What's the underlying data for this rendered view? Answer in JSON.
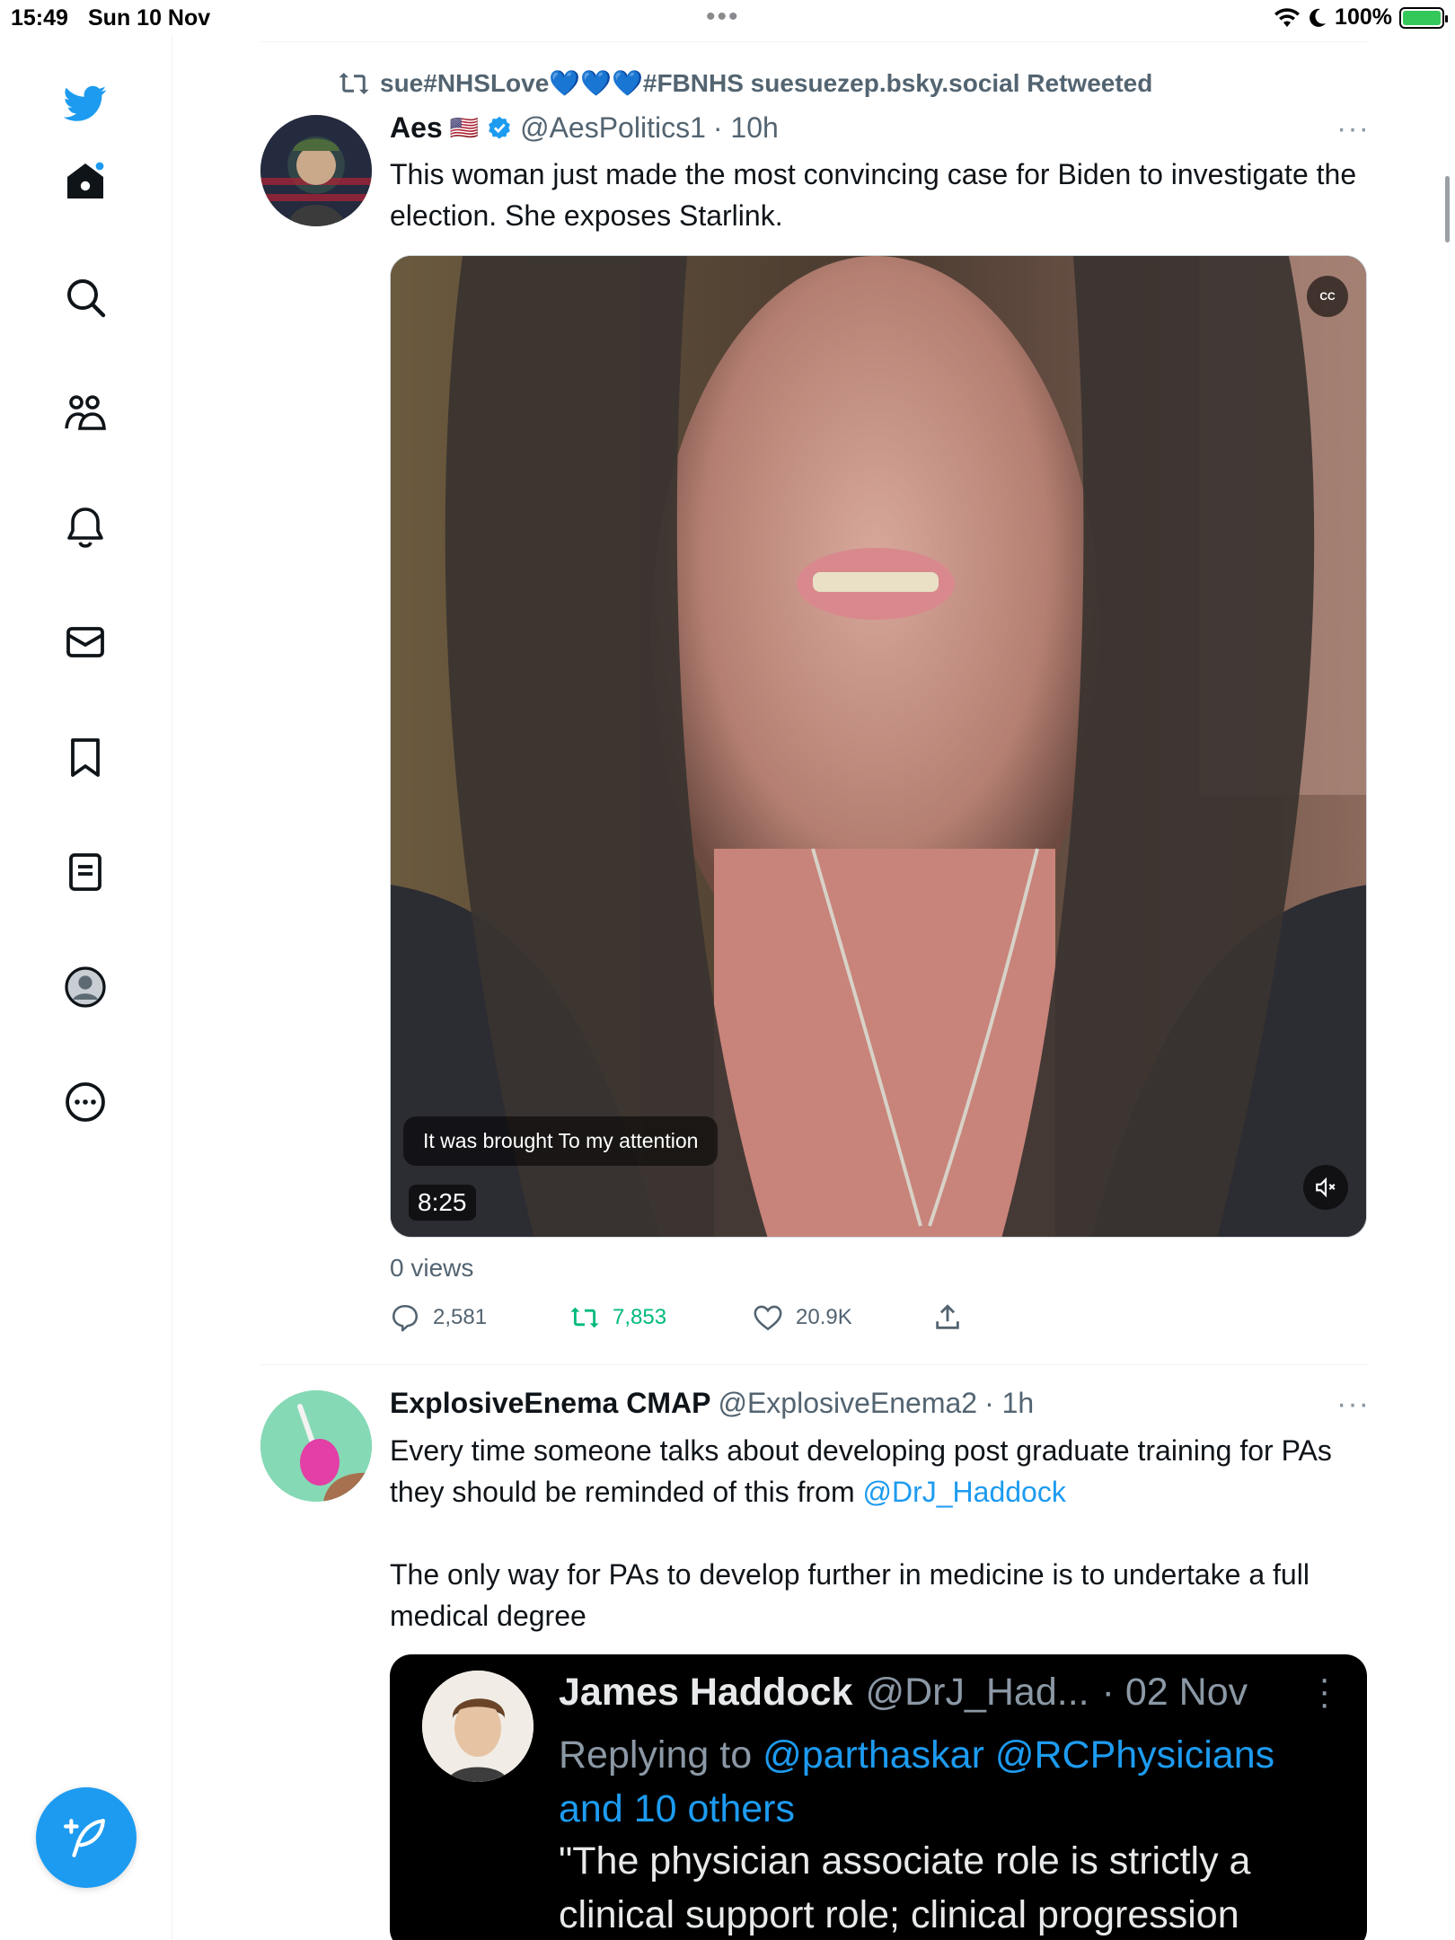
{
  "status_bar": {
    "time": "15:49",
    "date": "Sun 10 Nov",
    "battery": "100%",
    "battery_level": 1.0
  },
  "sidebar": {
    "items": [
      {
        "name": "home",
        "icon": "home-icon"
      },
      {
        "name": "explore",
        "icon": "search-icon"
      },
      {
        "name": "communities",
        "icon": "communities-icon"
      },
      {
        "name": "notifications",
        "icon": "bell-icon"
      },
      {
        "name": "messages",
        "icon": "mail-icon"
      },
      {
        "name": "bookmarks",
        "icon": "bookmark-icon"
      },
      {
        "name": "lists",
        "icon": "lists-icon"
      },
      {
        "name": "profile",
        "icon": "profile-avatar-icon"
      },
      {
        "name": "more",
        "icon": "more-circle-icon"
      }
    ],
    "compose_icon": "compose-feather-icon",
    "accent": "#1d9bf0"
  },
  "tweet1": {
    "retweeted_by": "sue#NHSLove💙💙💙#FBNHS suesuezep.bsky.social Retweeted",
    "name": "Aes",
    "flag": "🇺🇸",
    "handle": "@AesPolitics1",
    "time": "· 10h",
    "more": "···",
    "text": "This woman just made the most convincing case for Biden to investigate the election. She exposes Starlink.",
    "video": {
      "caption": "It was brought To my attention",
      "duration": "8:25",
      "cc": "CC"
    },
    "views": "0 views",
    "replies": "2,581",
    "retweets": "7,853",
    "likes": "20.9K"
  },
  "tweet2": {
    "name": "ExplosiveEnema CMAP",
    "handle": "@ExplosiveEnema2",
    "time": "· 1h",
    "more": "···",
    "text_part1": "Every time someone talks about developing post graduate training for PAs they should be reminded of this from ",
    "mention": "@DrJ_Haddock",
    "text_part2": "The only way for PAs to develop further in medicine is to undertake a full medical degree",
    "quote": {
      "name": "James Haddock",
      "handle": "@DrJ_Had...",
      "date": "· 02 Nov",
      "replying_prefix": "Replying to ",
      "replying_mentions": "@parthaskar @RCPhysicians and 10 others",
      "text": "\"The physician associate role is strictly a clinical support role; clinical progression"
    }
  }
}
